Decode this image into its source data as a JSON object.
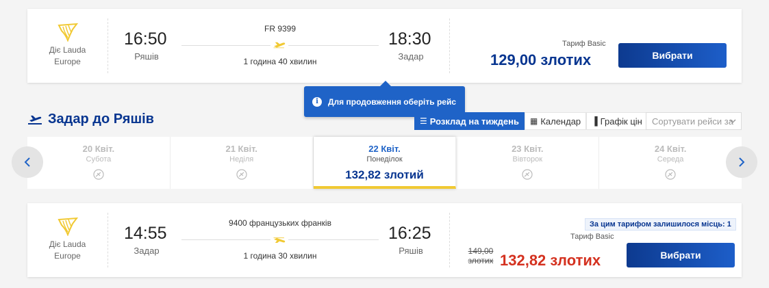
{
  "outbound": {
    "airline_name_line1": "Діє Lauda",
    "airline_name_line2": "Europe",
    "dep_time": "16:50",
    "dep_city": "Ряшів",
    "flight_number": "FR 9399",
    "duration": "1 година 40 хвилин",
    "arr_time": "18:30",
    "arr_city": "Задар",
    "tariff": "Тариф Basic",
    "price": "129,00 злотих",
    "select_label": "Вибрати"
  },
  "tooltip": {
    "text": "Для продовження оберіть рейс"
  },
  "return_section": {
    "title": "Задар до Ряшів",
    "tabs": [
      {
        "label": "Розклад на тиждень",
        "icon": "list-icon"
      },
      {
        "label": "Календар",
        "icon": "calendar-icon"
      },
      {
        "label": "Графік цін",
        "icon": "bar-chart-icon"
      }
    ],
    "sort_placeholder": "Сортувати рейси за"
  },
  "dates": [
    {
      "date": "20  Квіт.",
      "weekday": "Субота"
    },
    {
      "date": "21  Квіт.",
      "weekday": "Неділя"
    },
    {
      "date": "22  Квіт.",
      "weekday": "Понеділок",
      "price": "132,82 злотий"
    },
    {
      "date": "23  Квіт.",
      "weekday": "Вівторок"
    },
    {
      "date": "24  Квіт.",
      "weekday": "Середа"
    }
  ],
  "inbound": {
    "airline_name_line1": "Діє Lauda",
    "airline_name_line2": "Europe",
    "dep_time": "14:55",
    "dep_city": "Задар",
    "flight_number": "9400 французьких франків",
    "duration": "1 година 30 хвилин",
    "arr_time": "16:25",
    "arr_city": "Ряшів",
    "seats_left": "За цим тарифом залишилося місць: 1",
    "tariff": "Тариф Basic",
    "old_price_line1": "149,00",
    "old_price_line2": "злотих",
    "price": "132,82 злотих",
    "select_label": "Вибрати"
  },
  "colors": {
    "brand_blue": "#073590",
    "accent_blue": "#1f63c7",
    "accent_yellow": "#f1c933",
    "sale_red": "#d4311f"
  }
}
